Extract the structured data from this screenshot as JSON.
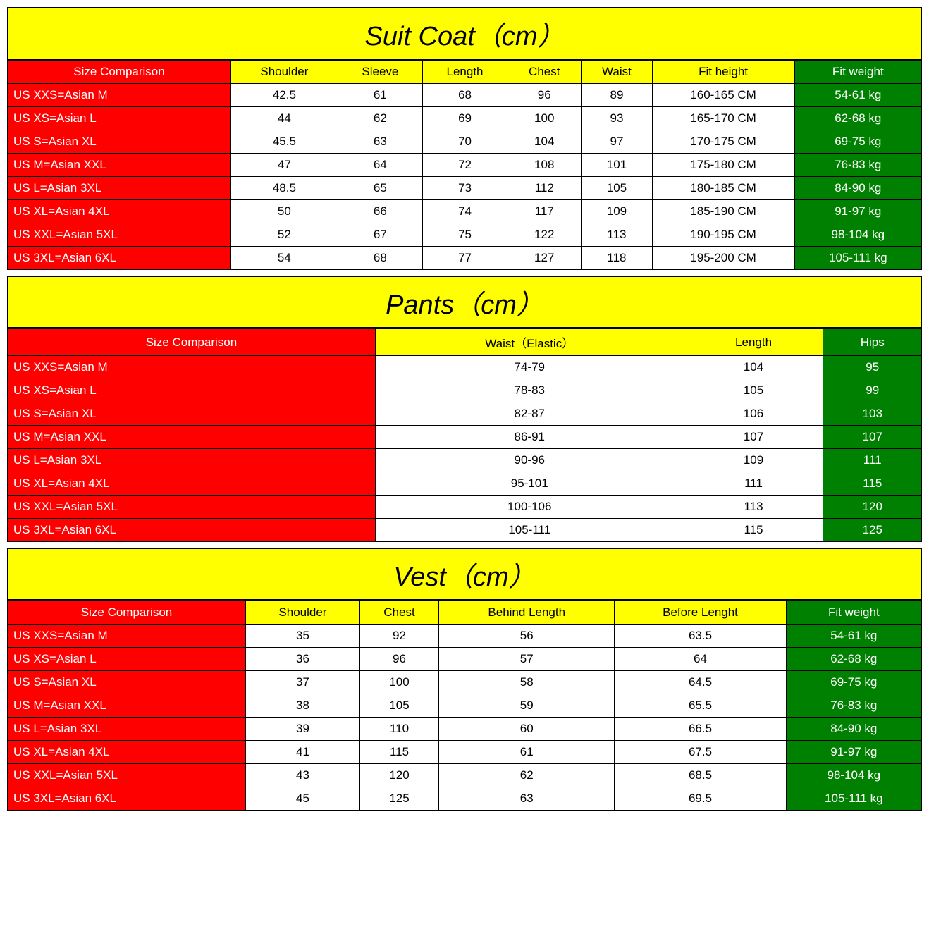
{
  "suit_coat": {
    "title": "Suit Coat（cm）",
    "headers": [
      "Size Comparison",
      "Shoulder",
      "Sleeve",
      "Length",
      "Chest",
      "Waist",
      "Fit height",
      "Fit weight"
    ],
    "rows": [
      [
        "US XXS=Asian M",
        "42.5",
        "61",
        "68",
        "96",
        "89",
        "160-165 CM",
        "54-61 kg"
      ],
      [
        "US XS=Asian L",
        "44",
        "62",
        "69",
        "100",
        "93",
        "165-170 CM",
        "62-68 kg"
      ],
      [
        "US S=Asian XL",
        "45.5",
        "63",
        "70",
        "104",
        "97",
        "170-175 CM",
        "69-75 kg"
      ],
      [
        "US M=Asian XXL",
        "47",
        "64",
        "72",
        "108",
        "101",
        "175-180 CM",
        "76-83 kg"
      ],
      [
        "US L=Asian 3XL",
        "48.5",
        "65",
        "73",
        "112",
        "105",
        "180-185 CM",
        "84-90 kg"
      ],
      [
        "US XL=Asian 4XL",
        "50",
        "66",
        "74",
        "117",
        "109",
        "185-190 CM",
        "91-97 kg"
      ],
      [
        "US XXL=Asian 5XL",
        "52",
        "67",
        "75",
        "122",
        "113",
        "190-195 CM",
        "98-104 kg"
      ],
      [
        "US 3XL=Asian 6XL",
        "54",
        "68",
        "77",
        "127",
        "118",
        "195-200 CM",
        "105-111 kg"
      ]
    ]
  },
  "pants": {
    "title": "Pants（cm）",
    "headers": [
      "Size Comparison",
      "Waist（Elastic）",
      "Length",
      "Hips"
    ],
    "rows": [
      [
        "US XXS=Asian M",
        "74-79",
        "104",
        "95"
      ],
      [
        "US XS=Asian L",
        "78-83",
        "105",
        "99"
      ],
      [
        "US S=Asian XL",
        "82-87",
        "106",
        "103"
      ],
      [
        "US M=Asian XXL",
        "86-91",
        "107",
        "107"
      ],
      [
        "US L=Asian 3XL",
        "90-96",
        "109",
        "111"
      ],
      [
        "US XL=Asian 4XL",
        "95-101",
        "111",
        "115"
      ],
      [
        "US XXL=Asian 5XL",
        "100-106",
        "113",
        "120"
      ],
      [
        "US 3XL=Asian 6XL",
        "105-111",
        "115",
        "125"
      ]
    ]
  },
  "vest": {
    "title": "Vest（cm）",
    "headers": [
      "Size Comparison",
      "Shoulder",
      "Chest",
      "Behind Length",
      "Before Lenght",
      "Fit weight"
    ],
    "rows": [
      [
        "US XXS=Asian M",
        "35",
        "92",
        "56",
        "63.5",
        "54-61 kg"
      ],
      [
        "US XS=Asian L",
        "36",
        "96",
        "57",
        "64",
        "62-68 kg"
      ],
      [
        "US S=Asian XL",
        "37",
        "100",
        "58",
        "64.5",
        "69-75 kg"
      ],
      [
        "US M=Asian XXL",
        "38",
        "105",
        "59",
        "65.5",
        "76-83 kg"
      ],
      [
        "US L=Asian 3XL",
        "39",
        "110",
        "60",
        "66.5",
        "84-90 kg"
      ],
      [
        "US XL=Asian 4XL",
        "41",
        "115",
        "61",
        "67.5",
        "91-97 kg"
      ],
      [
        "US XXL=Asian 5XL",
        "43",
        "120",
        "62",
        "68.5",
        "98-104 kg"
      ],
      [
        "US 3XL=Asian 6XL",
        "45",
        "125",
        "63",
        "69.5",
        "105-111 kg"
      ]
    ]
  }
}
